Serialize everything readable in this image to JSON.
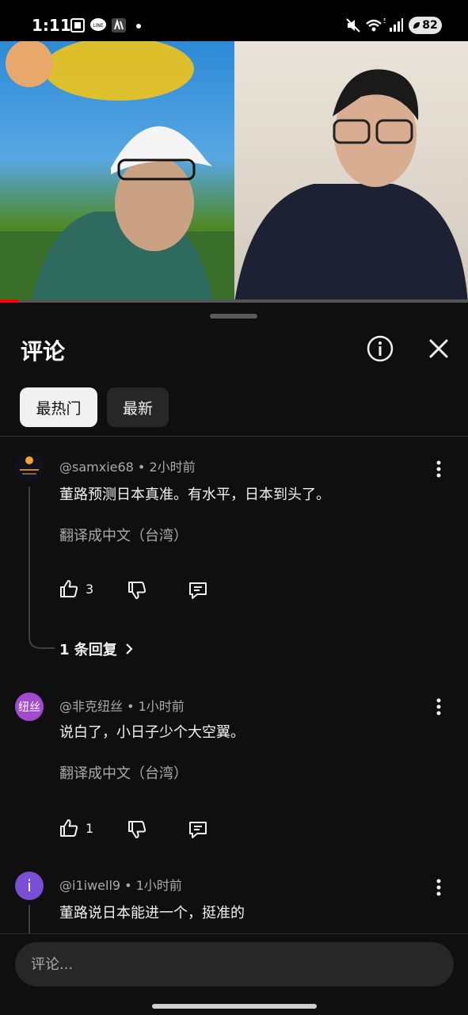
{
  "status_bar": {
    "time": "1:11",
    "battery": "82",
    "wifi_label": "5"
  },
  "video": {
    "progress_fraction": 0.04
  },
  "sheet": {
    "title": "评论",
    "chips": [
      {
        "label": "最热门",
        "active": true
      },
      {
        "label": "最新",
        "active": false
      }
    ]
  },
  "comments": [
    {
      "author": "@samxie68",
      "time": "2小时前",
      "text": "董路预测日本真准。有水平，日本到头了。",
      "translate": "翻译成中文（台湾）",
      "likes": "3",
      "replies": "1 条回复"
    },
    {
      "author": "@非克纽丝",
      "time": "1小时前",
      "avatar_text": "纽丝",
      "text": "说白了，小日子少个大空翼。",
      "translate": "翻译成中文（台湾）",
      "likes": "1"
    },
    {
      "author": "@i1iwell9",
      "time": "1小时前",
      "avatar_text": "i",
      "text": "董路说日本能进一个，挺准的"
    }
  ],
  "comment_input": {
    "placeholder": "评论..."
  },
  "colors": {
    "background": "#0f0f0f",
    "purple_avatar": "#a24bd0",
    "violet_avatar": "#7a4fd6"
  }
}
